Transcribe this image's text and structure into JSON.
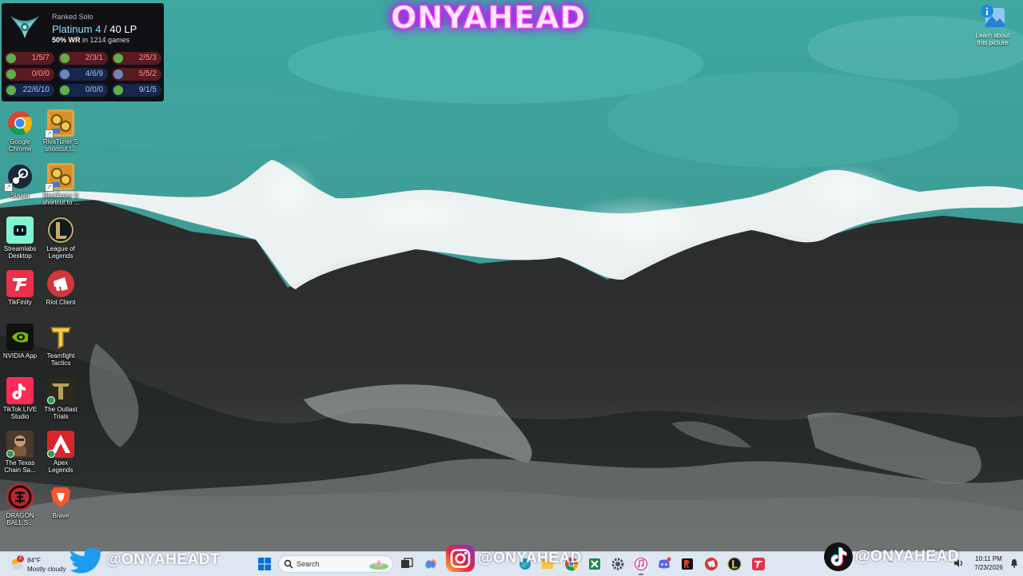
{
  "overlay": {
    "stream_title": "ONYAHEAD",
    "twitter_handle": "@ONYAHEADT",
    "instagram_handle": "@ONYAHEAD",
    "tiktok_handle": "@ONYAHEAD"
  },
  "rank_widget": {
    "queue": "Ranked Solo",
    "tier": "Platinum 4",
    "separator": " / ",
    "lp": "40 LP",
    "winrate": "50% WR",
    "games_text": "in 1214 games",
    "matches": [
      {
        "kda": "1/5/7",
        "result": "loss",
        "champ_color": "#5fae4a"
      },
      {
        "kda": "2/3/1",
        "result": "loss",
        "champ_color": "#5fae4a"
      },
      {
        "kda": "2/5/3",
        "result": "loss",
        "champ_color": "#5fae4a"
      },
      {
        "kda": "0/0/0",
        "result": "loss",
        "champ_color": "#5fae4a"
      },
      {
        "kda": "4/6/9",
        "result": "win",
        "champ_color": "#6d86b8"
      },
      {
        "kda": "5/5/2",
        "result": "loss",
        "champ_color": "#6d86b8"
      },
      {
        "kda": "22/6/10",
        "result": "win",
        "champ_color": "#5fae4a"
      },
      {
        "kda": "0/0/0",
        "result": "win",
        "champ_color": "#5fae4a"
      },
      {
        "kda": "9/1/5",
        "result": "win",
        "champ_color": "#5fae4a"
      }
    ]
  },
  "desktop_icons": [
    {
      "line1": "Google",
      "line2": "Chrome",
      "icon": "chrome-icon"
    },
    {
      "line1": "RivaTuner S",
      "line2": "shortcut t...",
      "icon": "rivatuner-icon"
    },
    {
      "line1": "Steam",
      "line2": "",
      "icon": "steam-icon"
    },
    {
      "line1": "RivaTuner S",
      "line2": "shortcut to ...",
      "icon": "rivatuner-icon"
    },
    {
      "line1": "Streamlabs",
      "line2": "Desktop",
      "icon": "streamlabs-icon"
    },
    {
      "line1": "League of",
      "line2": "Legends",
      "icon": "league-of-legends-icon"
    },
    {
      "line1": "TikFinity",
      "line2": "",
      "icon": "tikfinity-icon"
    },
    {
      "line1": "Riot Client",
      "line2": "",
      "icon": "riot-client-icon"
    },
    {
      "line1": "NVIDIA App",
      "line2": "",
      "icon": "nvidia-icon"
    },
    {
      "line1": "Teamfight",
      "line2": "Tactics",
      "icon": "teamfight-tactics-icon"
    },
    {
      "line1": "TikTok LIVE",
      "line2": "Studio",
      "icon": "tiktok-live-studio-icon"
    },
    {
      "line1": "The Outlast",
      "line2": "Trials",
      "icon": "outlast-trials-icon"
    },
    {
      "line1": "The Texas",
      "line2": "Chain Sa...",
      "icon": "texas-chain-saw-icon"
    },
    {
      "line1": "Apex",
      "line2": "Legends",
      "icon": "apex-legends-icon"
    },
    {
      "line1": "DRAGON",
      "line2": "BALL S...",
      "icon": "dragon-ball-icon"
    },
    {
      "line1": "Brave",
      "line2": "",
      "icon": "brave-icon"
    }
  ],
  "learn_about": {
    "line1": "Learn about",
    "line2": "this picture"
  },
  "taskbar": {
    "weather_temp": "84°F",
    "weather_condition": "Mostly cloudy",
    "weather_badge": "2",
    "search_placeholder": "Search",
    "tray_arrow": "^",
    "clock_time": "10:11 PM",
    "clock_date": "7/23/2026",
    "apps": [
      "task-view-icon",
      "copilot-icon",
      "file-explorer-icon",
      "edge-icon",
      "excel-icon",
      "chrome-icon",
      "settings-icon",
      "itunes-icon",
      "discord-icon",
      "rockstar-icon",
      "riot-client-icon",
      "league-of-legends-icon",
      "tikfinity-icon"
    ]
  },
  "colors": {
    "taskbar_bg": "#dde6f1",
    "neon_title": "#ff30ff",
    "widget_bg": "#0f1014",
    "tier_color": "#8fe0ff",
    "loss_bg": "#5a1a22",
    "win_bg": "#17264a"
  }
}
